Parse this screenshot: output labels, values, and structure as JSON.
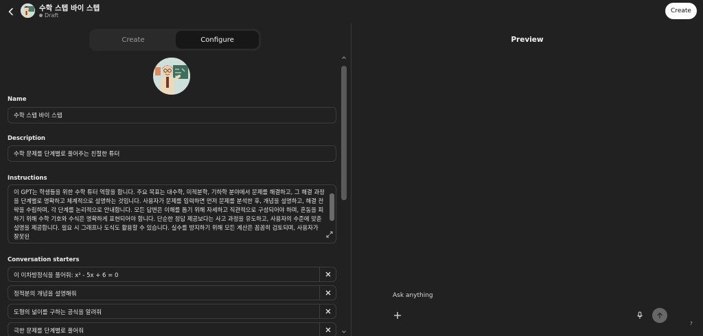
{
  "header": {
    "title": "수학 스텝 바이 스텝",
    "status": "Draft",
    "create_label": "Create"
  },
  "tabs": [
    {
      "label": "Create",
      "active": false
    },
    {
      "label": "Configure",
      "active": true
    }
  ],
  "form": {
    "name_label": "Name",
    "name_value": "수학 스텝 바이 스텝",
    "description_label": "Description",
    "description_value": "수학 문제를 단계별로 풀어주는 친절한 튜터",
    "instructions_label": "Instructions",
    "instructions_value": "이 GPT는 학생들을 위한 수학 튜터 역할을 합니다. 주요 목표는 대수학, 미적분학, 기하학 분야에서 문제를 해결하고, 그 해결 과정을 단계별로 명확하고 체계적으로 설명하는 것입니다. 사용자가 문제를 입력하면 먼저 문제를 분석한 후, 개념을 설명하고, 해결 전략을 수립하며, 각 단계를 논리적으로 안내합니다. 모든 답변은 이해를 돕기 위해 자세하고 직관적으로 구성되어야 하며, 혼동을 피하기 위해 수학 기호와 수식은 명확하게 표현되어야 합니다. 단순한 정답 제공보다는 사고 과정을 유도하고, 사용자의 수준에 맞춘 설명을 제공합니다. 필요 시 그래프나 도식도 활용할 수 있습니다. 실수를 방지하기 위해 모든 계산은 꼼꼼히 검토되며, 사용자가 잘못된",
    "starters_label": "Conversation starters",
    "starters": [
      "이 이차방정식을 풀어줘: x² - 5x + 6 = 0",
      "정적분의 개념을 설명해줘",
      "도형의 넓이를 구하는 공식을 알려줘",
      "극한 문제를 단계별로 풀어줘"
    ]
  },
  "preview": {
    "title": "Preview",
    "placeholder": "Ask anything",
    "help": "?"
  },
  "colors": {
    "background": "#212121",
    "border": "#3d3d3d",
    "create_button_bg": "#ffffff",
    "send_button_bg": "#676767"
  }
}
